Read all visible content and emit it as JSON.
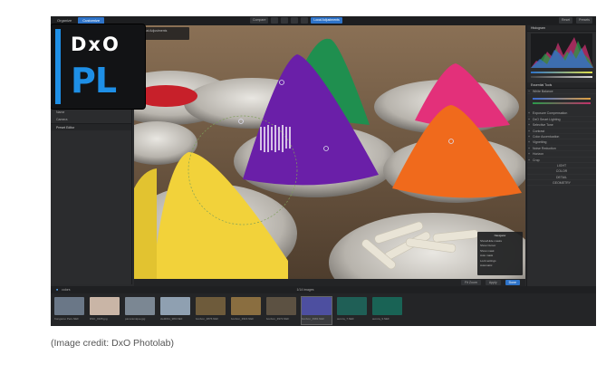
{
  "app": {
    "tabs": [
      {
        "label": "Organize"
      },
      {
        "label": "Customize"
      }
    ],
    "toolbar_mid": [
      "Compare",
      "",
      "",
      "",
      "",
      "Local Adjustments"
    ],
    "toolbar_right": [
      "Reset",
      "Presets"
    ]
  },
  "logo": {
    "top": "DxO",
    "bottom": "PL"
  },
  "left_panel": {
    "rows": [
      "Preset Editor"
    ],
    "items": [
      "Name",
      "Camera"
    ]
  },
  "photo": {
    "local_adjust_label": "Local Adjustments",
    "navigator": {
      "title": "Navigator",
      "rows": [
        "Show/Hide masks",
        "Show Cursor",
        "Show mask",
        "Auto mask",
        "Lock settings",
        "Automatic"
      ]
    }
  },
  "viewbar": {
    "buttons": [
      "Fit Zoom",
      "Apply",
      "Done"
    ]
  },
  "right_panel": {
    "histogram_title": "Histogram",
    "section": "Essential Tools",
    "rows": [
      "White Balance",
      "Exposure Compensation",
      "DxO Smart Lighting",
      "Selective Tone",
      "Contrast",
      "Color Accentuation",
      "Vignetting",
      "Noise Reduction",
      "Horizon",
      "Crop"
    ],
    "palettes": [
      "LIGHT",
      "COLOR",
      "DETAIL",
      "GEOMETRY"
    ]
  },
  "filmbar": {
    "path": "colors",
    "count": "1/14 images"
  },
  "filmstrip": [
    {
      "caption": "Kangaroo Peru.NEF",
      "color": "#6a7787"
    },
    {
      "caption": "DSC_0105.jpg",
      "color": "#c9b5a6"
    },
    {
      "caption": "panoramique.jpg",
      "color": "#7b8793"
    },
    {
      "caption": "ciel2011_980.NEF",
      "color": "#8fa0b1"
    },
    {
      "caption": "bonbon_3876.NEF",
      "color": "#6e5b3b"
    },
    {
      "caption": "bonbon_3916.NEF",
      "color": "#8a6e40"
    },
    {
      "caption": "bonbon_3972.NEF",
      "color": "#5c5142"
    },
    {
      "caption": "bonbon_3981.NEF",
      "color": "#4d4fa0"
    },
    {
      "caption": "aurora_7.NEF",
      "color": "#1f5f56"
    },
    {
      "caption": "aurora_9.NEF",
      "color": "#196355"
    }
  ],
  "credit": "(Image credit: DxO Photolab)"
}
